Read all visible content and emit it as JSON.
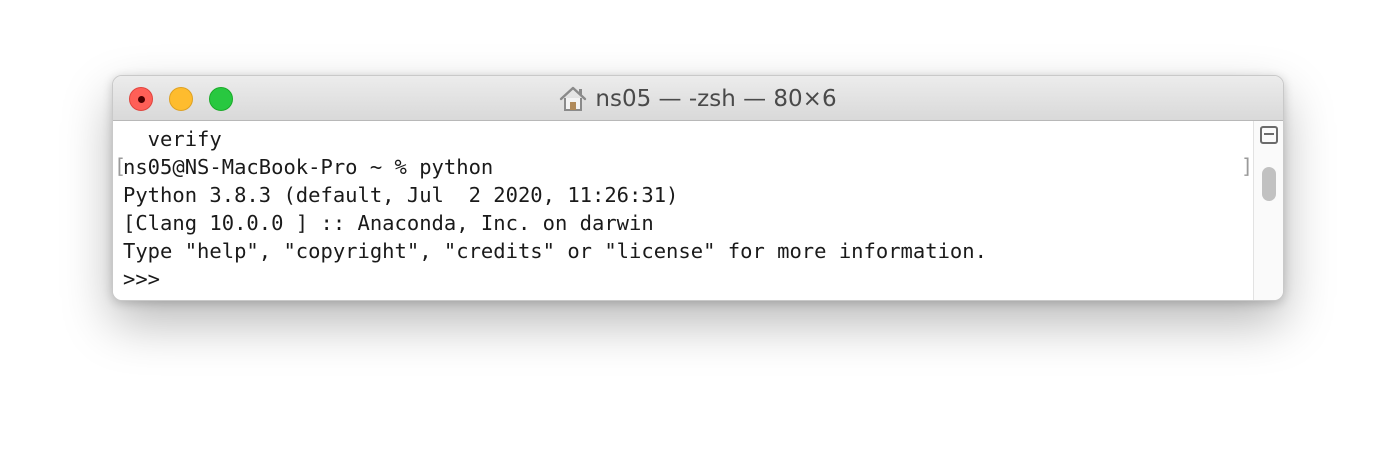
{
  "window": {
    "title": "ns05 — -zsh — 80×6",
    "title_icon": "home-icon"
  },
  "traffic_lights": {
    "close_color": "#ff5f57",
    "minimize_color": "#febc2e",
    "maximize_color": "#28c840"
  },
  "terminal": {
    "lines": [
      "  verify",
      "ns05@NS-MacBook-Pro ~ % python",
      "Python 3.8.3 (default, Jul  2 2020, 11:26:31)",
      "[Clang 10.0.0 ] :: Anaconda, Inc. on darwin",
      "Type \"help\", \"copyright\", \"credits\" or \"license\" for more information.",
      ">>>"
    ],
    "mark_open": "[",
    "mark_close": "]"
  },
  "scrollbar": {
    "split_icon": "split-pane-icon"
  }
}
